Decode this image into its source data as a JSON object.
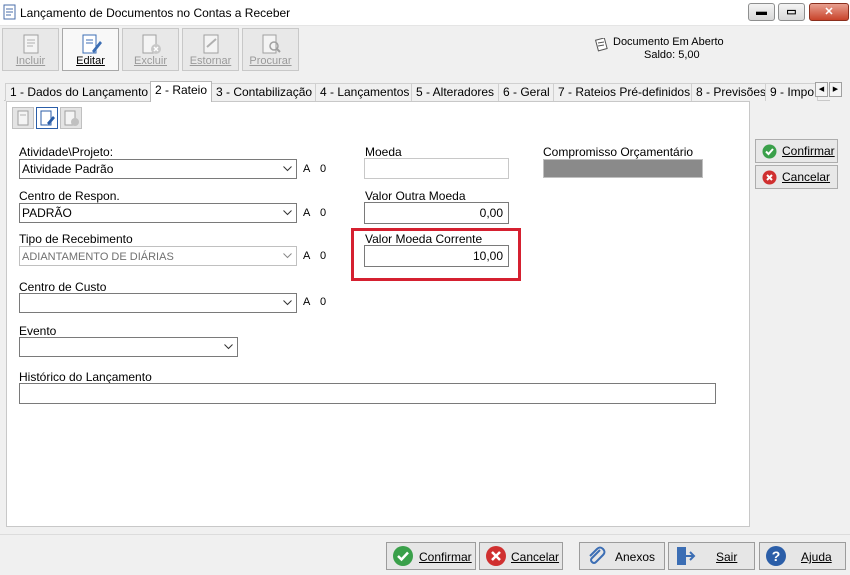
{
  "window": {
    "title": "Lançamento de Documentos no Contas a Receber",
    "min_glyph": "▬",
    "max_glyph": "▭",
    "close_glyph": "✕"
  },
  "toolbar": {
    "incluir": "Incluir",
    "editar": "Editar",
    "excluir": "Excluir",
    "estornar": "Estornar",
    "procurar": "Procurar"
  },
  "status": {
    "documento": "Documento Em Aberto",
    "saldo": "Saldo: 5,00"
  },
  "tabs": [
    {
      "label": "1 - Dados do Lançamento"
    },
    {
      "label": "2 - Rateio"
    },
    {
      "label": "3 - Contabilização"
    },
    {
      "label": "4 - Lançamentos"
    },
    {
      "label": "5 - Alteradores"
    },
    {
      "label": "6 - Geral"
    },
    {
      "label": "7 - Rateios Pré-definidos"
    },
    {
      "label": "8 - Previsões"
    },
    {
      "label": "9 - Impo"
    }
  ],
  "tab_scroll": {
    "left": "◀",
    "right": "▶"
  },
  "form": {
    "atividade": {
      "label": "Atividade\\Projeto:",
      "value": "Atividade Padrão",
      "flag_a": "A",
      "flag_0": "0"
    },
    "centro_respon": {
      "label": "Centro de Respon.",
      "value": "PADRÃO",
      "flag_a": "A",
      "flag_0": "0"
    },
    "tipo_recebimento": {
      "label": "Tipo de Recebimento",
      "value": "ADIANTAMENTO DE DIÁRIAS",
      "flag_a": "A",
      "flag_0": "0"
    },
    "centro_custo": {
      "label": "Centro de Custo",
      "value": "",
      "flag_a": "A",
      "flag_0": "0"
    },
    "evento": {
      "label": "Evento",
      "value": ""
    },
    "historico": {
      "label": "Histórico do Lançamento",
      "value": ""
    },
    "moeda": {
      "label": "Moeda",
      "value": ""
    },
    "valor_outra_moeda": {
      "label": "Valor Outra Moeda",
      "value": "0,00"
    },
    "valor_moeda_corrente": {
      "label": "Valor Moeda Corrente",
      "value": "10,00"
    },
    "compromisso": {
      "label": "Compromisso Orçamentário"
    }
  },
  "side_buttons": {
    "confirmar": "Confirmar",
    "cancelar": "Cancelar"
  },
  "bottom_buttons": {
    "confirmar": "Confirmar",
    "cancelar": "Cancelar",
    "anexos": "Anexos",
    "sair": "Sair",
    "ajuda": "Ajuda"
  },
  "colors": {
    "highlight": "#d52030",
    "confirm": "#3aa04a",
    "cancel": "#d03030",
    "accent": "#2b5ea8"
  }
}
